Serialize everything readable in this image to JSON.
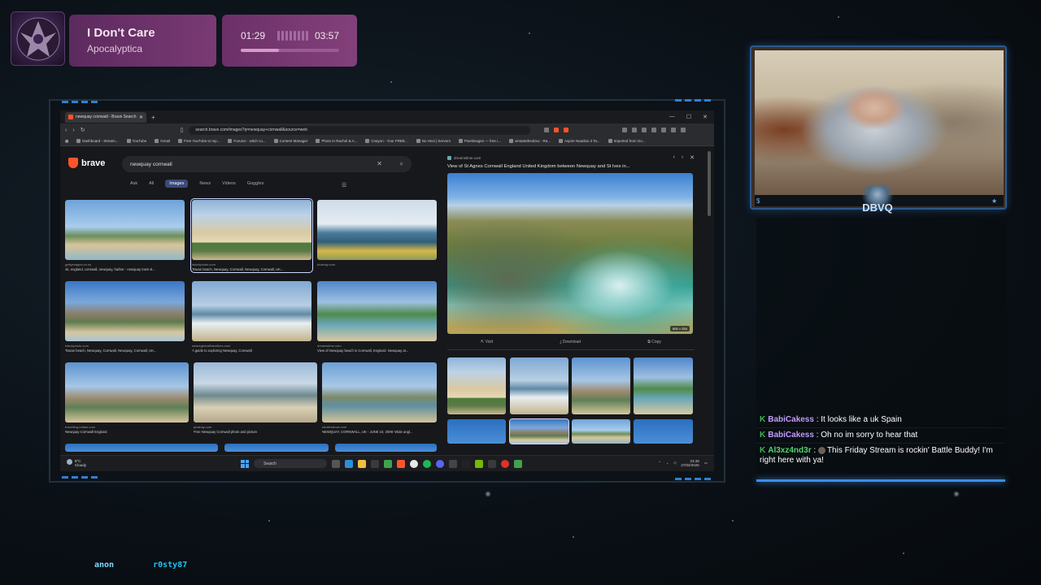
{
  "now_playing": {
    "title": "I Don't Care",
    "artist": "Apocalyptica",
    "current_time": "01:29",
    "total_time": "03:57",
    "progress": 0.39
  },
  "browser": {
    "tab_title": "newquay cornwall - Brave Search",
    "url": "search.brave.com/images?q=newquay+cornwall&source=web",
    "bookmarks": [
      "Dashboard - Stream...",
      "YouTube",
      "Gmail",
      "Free YouTube to mp...",
      "Forums - witch co...",
      "Content Manager",
      "Photo in Rachel & A...",
      "Craiyon - Your FREE...",
      "No Hesi | Servers",
      "Pixelimages — free i...",
      "virstatetheobvo - Ra...",
      "Aspire Nautilus 3 Ta...",
      "Imported from Go..."
    ],
    "search": {
      "logo_text": "brave",
      "query": "newquay cornwall",
      "tabs": [
        "Ask",
        "All",
        "Images",
        "News",
        "Videos",
        "Goggles"
      ],
      "active_tab": "Images"
    },
    "results": [
      {
        "source": "gettyimages.co.uk",
        "caption": "uk, england, cornwall, newquay, harbor - newquay town st..."
      },
      {
        "source": "istockphoto.com",
        "caption": "Towan beach, Newquay, Cornwall, Newquay, Cornwall, UK..."
      },
      {
        "source": "pixabay.com",
        "caption": ""
      },
      {
        "source": "istockphoto.com",
        "caption": "Towan beach, Newquay, Cornwall, Newquay, Cornwall, UK..."
      },
      {
        "source": "wearegloballtravellers.com",
        "caption": "A guide to exploring Newquay, Cornwall"
      },
      {
        "source": "dreamstime.com",
        "caption": "View of Newquay beach in Cornwall, England. Newquay at..."
      },
      {
        "source": "travelling-britain.com",
        "caption": "Newquay Cornwall England"
      },
      {
        "source": "pixabay.com",
        "caption": "Free Newquay Cornwall photo and picture"
      },
      {
        "source": "shutterstock.com",
        "caption": "NEWQUAY, CORNWALL, UK - JUNE 10, 2009: Wide angl..."
      }
    ],
    "preview": {
      "source": "dreamstime.com",
      "title": "View of St Agnes Cornwall England United Kingdom between Newquay and St Ives in...",
      "dimensions": "800 × 534",
      "actions": [
        "Visit",
        "Download",
        "Copy"
      ]
    },
    "taskbar": {
      "temp": "8°C",
      "weather": "Cloudy",
      "search_label": "Search",
      "time": "23:48",
      "date": "27/02/2026"
    }
  },
  "webcam": {
    "logo_text": "DBVQ"
  },
  "chat": [
    {
      "user": "BabiCakess",
      "color": "#c39bff",
      "text": "It looks like a uk Spain"
    },
    {
      "user": "BabiCakess",
      "color": "#c39bff",
      "text": "Oh no im sorry to hear that"
    },
    {
      "user": "Al3xz4nd3r",
      "color": "#56d46b",
      "text": "This Friday Stream is rockin' Battle Buddy! I'm right here with ya!"
    }
  ],
  "bottom_names": [
    "anon",
    "r0sty87"
  ],
  "colors": {
    "accent_blue": "#3d8de8",
    "np_purple": "#7a3a74",
    "brave_orange": "#fb542b"
  }
}
